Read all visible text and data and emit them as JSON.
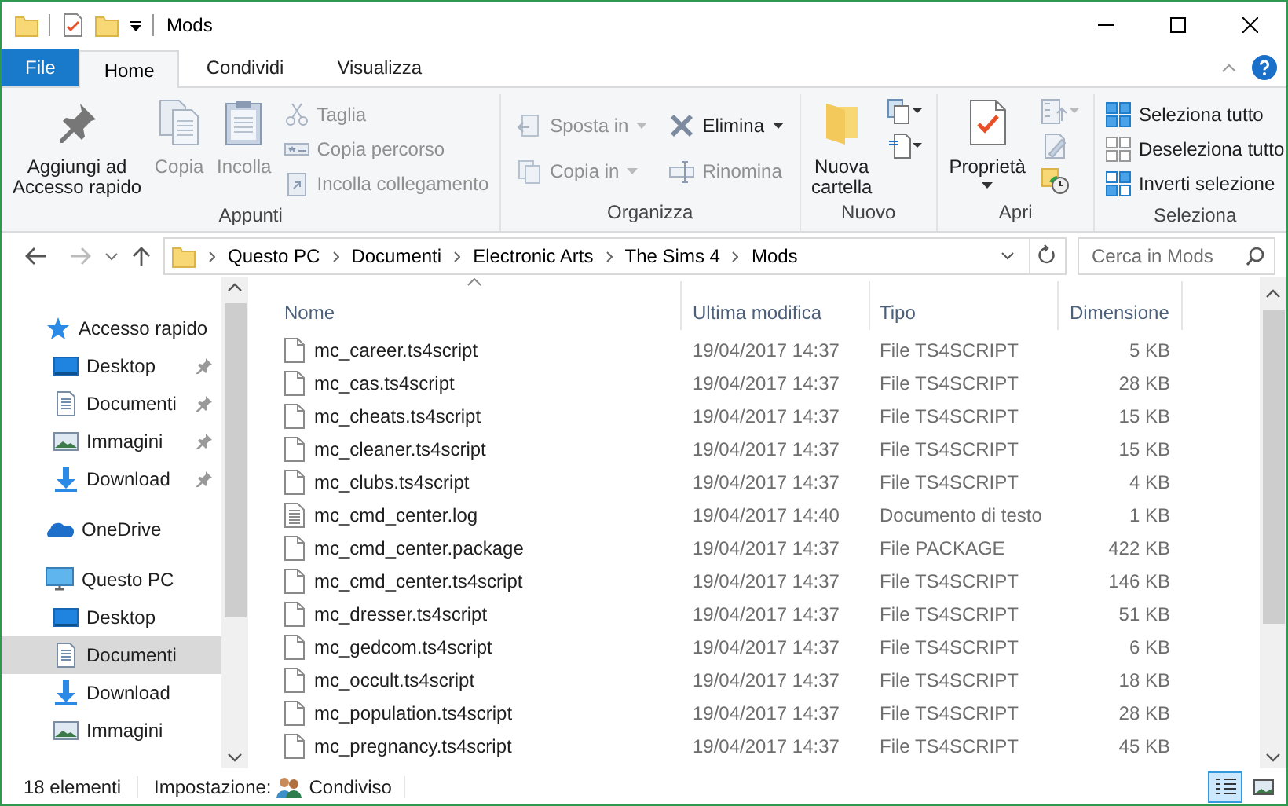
{
  "window": {
    "title": "Mods"
  },
  "ribbon_tabs": [
    {
      "label": "File",
      "kind": "file",
      "selected": false
    },
    {
      "label": "Home",
      "kind": "tab",
      "selected": true
    },
    {
      "label": "Condividi",
      "kind": "tab",
      "selected": false
    },
    {
      "label": "Visualizza",
      "kind": "tab",
      "selected": false
    }
  ],
  "ribbon_groups": [
    {
      "label": "Appunti",
      "columns": [
        {
          "kind": "large",
          "items": [
            {
              "label": "Aggiungi ad\nAccesso rapido",
              "disabled": false
            }
          ]
        },
        {
          "kind": "large",
          "items": [
            {
              "label": "Copia",
              "disabled": true
            }
          ]
        },
        {
          "kind": "large",
          "items": [
            {
              "label": "Incolla",
              "disabled": true
            }
          ]
        },
        {
          "kind": "small",
          "items": [
            {
              "label": "Taglia",
              "disabled": true
            },
            {
              "label": "Copia percorso",
              "disabled": true
            },
            {
              "label": "Incolla collegamento",
              "disabled": true
            }
          ]
        }
      ]
    },
    {
      "label": "Organizza",
      "columns": [
        {
          "kind": "wide",
          "items": [
            {
              "label": "Sposta in",
              "disabled": true,
              "dropdown": true
            },
            {
              "label": "Copia in",
              "disabled": true,
              "dropdown": true
            }
          ]
        },
        {
          "kind": "wide",
          "items": [
            {
              "label": "Elimina",
              "disabled": false,
              "dropdown": true
            },
            {
              "label": "Rinomina",
              "disabled": true
            }
          ]
        }
      ]
    },
    {
      "label": "Nuovo",
      "columns": [
        {
          "kind": "large",
          "items": [
            {
              "label": "Nuova\ncartella",
              "disabled": false
            }
          ]
        }
      ]
    },
    {
      "label": "Apri",
      "columns": [
        {
          "kind": "large",
          "items": [
            {
              "label": "Proprietà",
              "disabled": false,
              "dropdown": true
            }
          ]
        }
      ]
    },
    {
      "label": "Seleziona",
      "columns": [
        {
          "kind": "small",
          "items": [
            {
              "label": "Seleziona tutto",
              "disabled": false
            },
            {
              "label": "Deseleziona tutto",
              "disabled": false
            },
            {
              "label": "Inverti selezione",
              "disabled": false
            }
          ]
        }
      ]
    }
  ],
  "address_bar": {
    "breadcrumbs": [
      "Questo PC",
      "Documenti",
      "Electronic Arts",
      "The Sims 4",
      "Mods"
    ]
  },
  "search": {
    "placeholder": "Cerca in Mods"
  },
  "sidebar": {
    "items": [
      {
        "label": "Accesso rapido",
        "kind": "star",
        "selected": false,
        "children": [
          {
            "label": "Desktop",
            "kind": "desktop",
            "selected": false,
            "pinned": true
          },
          {
            "label": "Documenti",
            "kind": "documents",
            "selected": false,
            "pinned": true
          },
          {
            "label": "Immagini",
            "kind": "images",
            "selected": false,
            "pinned": true
          },
          {
            "label": "Download",
            "kind": "download",
            "selected": false,
            "pinned": true
          }
        ]
      },
      {
        "label": "OneDrive",
        "kind": "cloud",
        "selected": false
      },
      {
        "label": "Questo PC",
        "kind": "pc",
        "selected": false,
        "children": [
          {
            "label": "Desktop",
            "kind": "desktop",
            "selected": false,
            "pinned": false
          },
          {
            "label": "Documenti",
            "kind": "documents",
            "selected": true,
            "pinned": false
          },
          {
            "label": "Download",
            "kind": "download",
            "selected": false,
            "pinned": false
          },
          {
            "label": "Immagini",
            "kind": "images",
            "selected": false,
            "pinned": false
          }
        ]
      }
    ]
  },
  "file_list": {
    "columns": [
      {
        "label": "Nome",
        "sorted": true
      },
      {
        "label": "Ultima modifica",
        "sorted": false
      },
      {
        "label": "Tipo",
        "sorted": false
      },
      {
        "label": "Dimensione",
        "sorted": false
      }
    ],
    "rows": [
      {
        "kind": "file",
        "name": "mc_career.ts4script",
        "modified": "19/04/2017 14:37",
        "type": "File TS4SCRIPT",
        "size": "5 KB"
      },
      {
        "kind": "file",
        "name": "mc_cas.ts4script",
        "modified": "19/04/2017 14:37",
        "type": "File TS4SCRIPT",
        "size": "28 KB"
      },
      {
        "kind": "file",
        "name": "mc_cheats.ts4script",
        "modified": "19/04/2017 14:37",
        "type": "File TS4SCRIPT",
        "size": "15 KB"
      },
      {
        "kind": "file",
        "name": "mc_cleaner.ts4script",
        "modified": "19/04/2017 14:37",
        "type": "File TS4SCRIPT",
        "size": "15 KB"
      },
      {
        "kind": "file",
        "name": "mc_clubs.ts4script",
        "modified": "19/04/2017 14:37",
        "type": "File TS4SCRIPT",
        "size": "4 KB"
      },
      {
        "kind": "text",
        "name": "mc_cmd_center.log",
        "modified": "19/04/2017 14:40",
        "type": "Documento di testo",
        "size": "1 KB"
      },
      {
        "kind": "file",
        "name": "mc_cmd_center.package",
        "modified": "19/04/2017 14:37",
        "type": "File PACKAGE",
        "size": "422 KB"
      },
      {
        "kind": "file",
        "name": "mc_cmd_center.ts4script",
        "modified": "19/04/2017 14:37",
        "type": "File TS4SCRIPT",
        "size": "146 KB"
      },
      {
        "kind": "file",
        "name": "mc_dresser.ts4script",
        "modified": "19/04/2017 14:37",
        "type": "File TS4SCRIPT",
        "size": "51 KB"
      },
      {
        "kind": "file",
        "name": "mc_gedcom.ts4script",
        "modified": "19/04/2017 14:37",
        "type": "File TS4SCRIPT",
        "size": "6 KB"
      },
      {
        "kind": "file",
        "name": "mc_occult.ts4script",
        "modified": "19/04/2017 14:37",
        "type": "File TS4SCRIPT",
        "size": "18 KB"
      },
      {
        "kind": "file",
        "name": "mc_population.ts4script",
        "modified": "19/04/2017 14:37",
        "type": "File TS4SCRIPT",
        "size": "28 KB"
      },
      {
        "kind": "file",
        "name": "mc_pregnancy.ts4script",
        "modified": "19/04/2017 14:37",
        "type": "File TS4SCRIPT",
        "size": "45 KB"
      }
    ]
  },
  "status_bar": {
    "item_count": "18 elementi",
    "sharing_label": "Impostazione:",
    "sharing_value": "Condiviso",
    "views": [
      {
        "kind": "details",
        "selected": true
      },
      {
        "kind": "thumbnails",
        "selected": false
      }
    ]
  }
}
